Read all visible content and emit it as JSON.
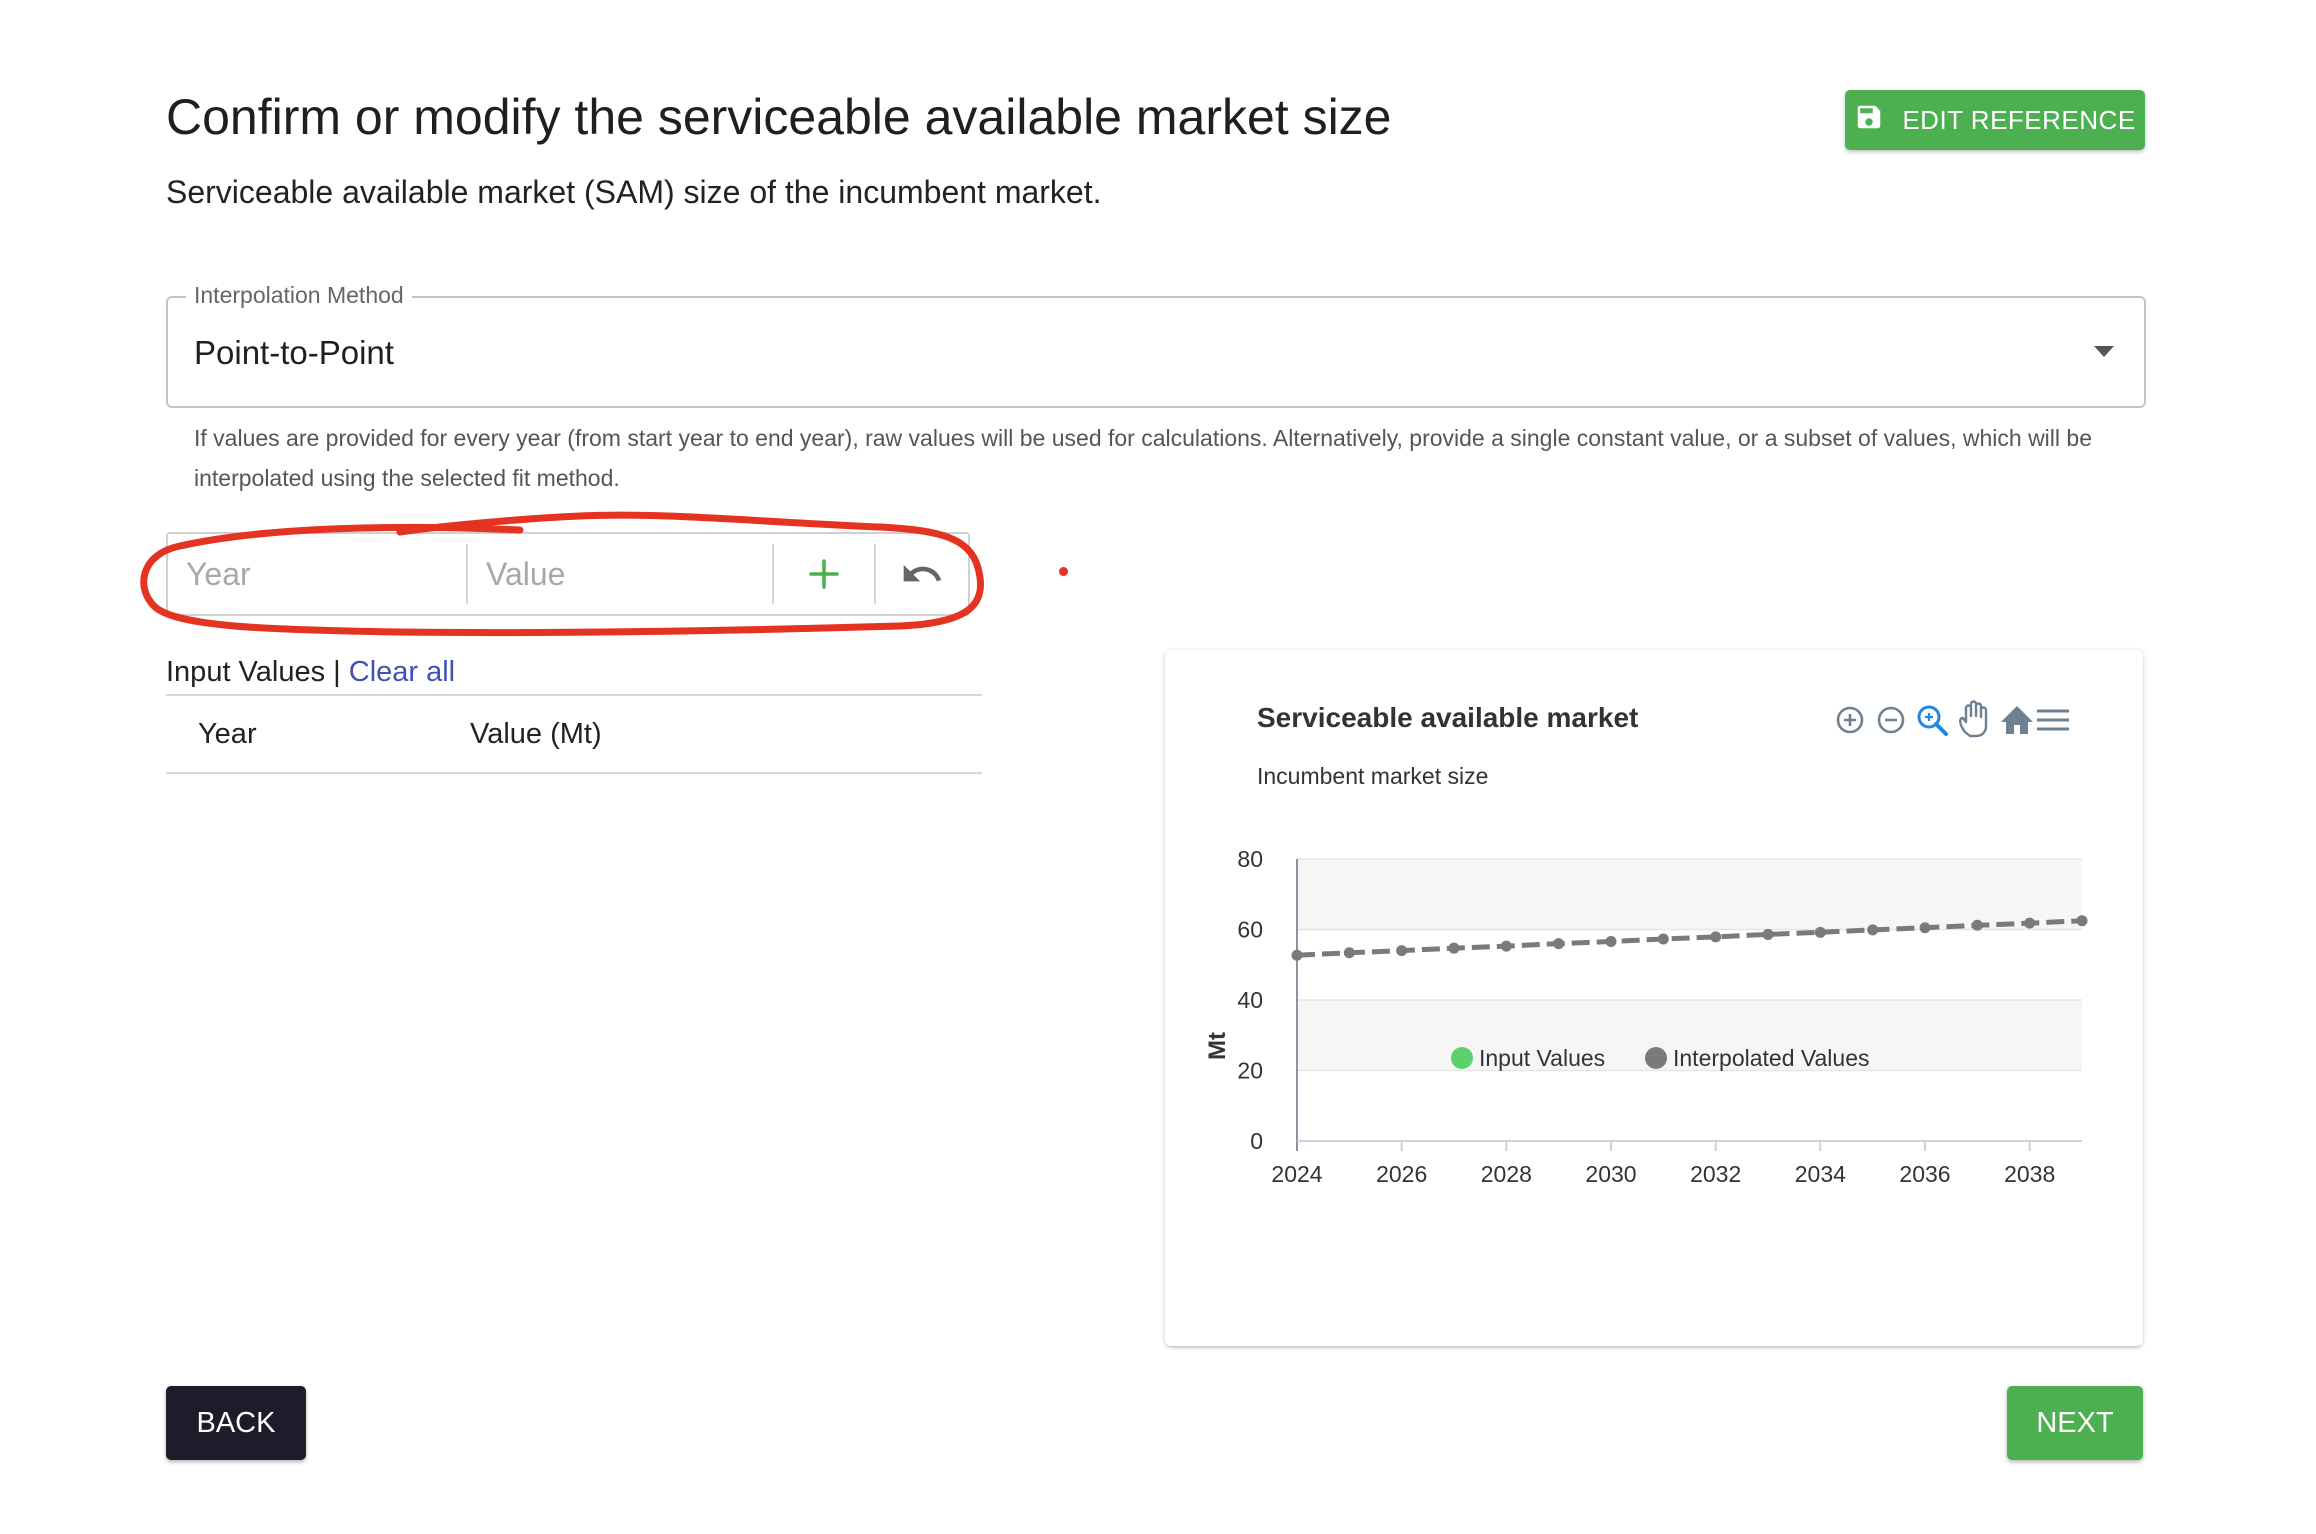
{
  "header": {
    "title": "Confirm or modify the serviceable available market size",
    "subtitle": "Serviceable available market (SAM) size of the incumbent market.",
    "edit_reference_label": "EDIT REFERENCE"
  },
  "interpolation": {
    "label": "Interpolation Method",
    "selected": "Point-to-Point",
    "helper_text": "If values are provided for every year (from start year to end year), raw values will be used for calculations. Alternatively, provide a single constant value, or a subset of values, which will be interpolated using the selected fit method."
  },
  "entry": {
    "year_placeholder": "Year",
    "value_placeholder": "Value"
  },
  "input_values": {
    "label": "Input Values",
    "separator": "|",
    "clear_all": "Clear all",
    "columns": [
      "Year",
      "Value (Mt)"
    ],
    "rows": []
  },
  "chart": {
    "toolbar_icons": [
      "zoom-in-icon",
      "zoom-out-icon",
      "selection-zoom-icon",
      "pan-hand-icon",
      "home-reset-icon",
      "menu-icon"
    ],
    "colors": {
      "input": "#5ccf6e",
      "interpolated": "#7a7a7a",
      "accent_icon": "#1e88e5"
    }
  },
  "chart_data": {
    "type": "line",
    "title": "Serviceable available market",
    "subtitle": "Incumbent market size",
    "ylabel": "Mt",
    "ylim": [
      0,
      80
    ],
    "yticks": [
      0,
      20,
      40,
      60,
      80
    ],
    "xlim": [
      2024,
      2039
    ],
    "xticks": [
      2024,
      2026,
      2028,
      2030,
      2032,
      2034,
      2036,
      2038
    ],
    "legend": [
      "Input Values",
      "Interpolated Values"
    ],
    "legend_position": "bottom",
    "series": [
      {
        "name": "Input Values",
        "x": [],
        "y": []
      },
      {
        "name": "Interpolated Values",
        "x": [
          2024,
          2025,
          2026,
          2027,
          2028,
          2029,
          2030,
          2031,
          2032,
          2033,
          2034,
          2035,
          2036,
          2037,
          2038,
          2039
        ],
        "y": [
          52.7,
          53.4,
          54.0,
          54.7,
          55.3,
          56.0,
          56.6,
          57.3,
          57.9,
          58.6,
          59.2,
          59.9,
          60.5,
          61.2,
          61.8,
          62.5
        ]
      }
    ]
  },
  "footer": {
    "back_label": "BACK",
    "next_label": "NEXT"
  }
}
